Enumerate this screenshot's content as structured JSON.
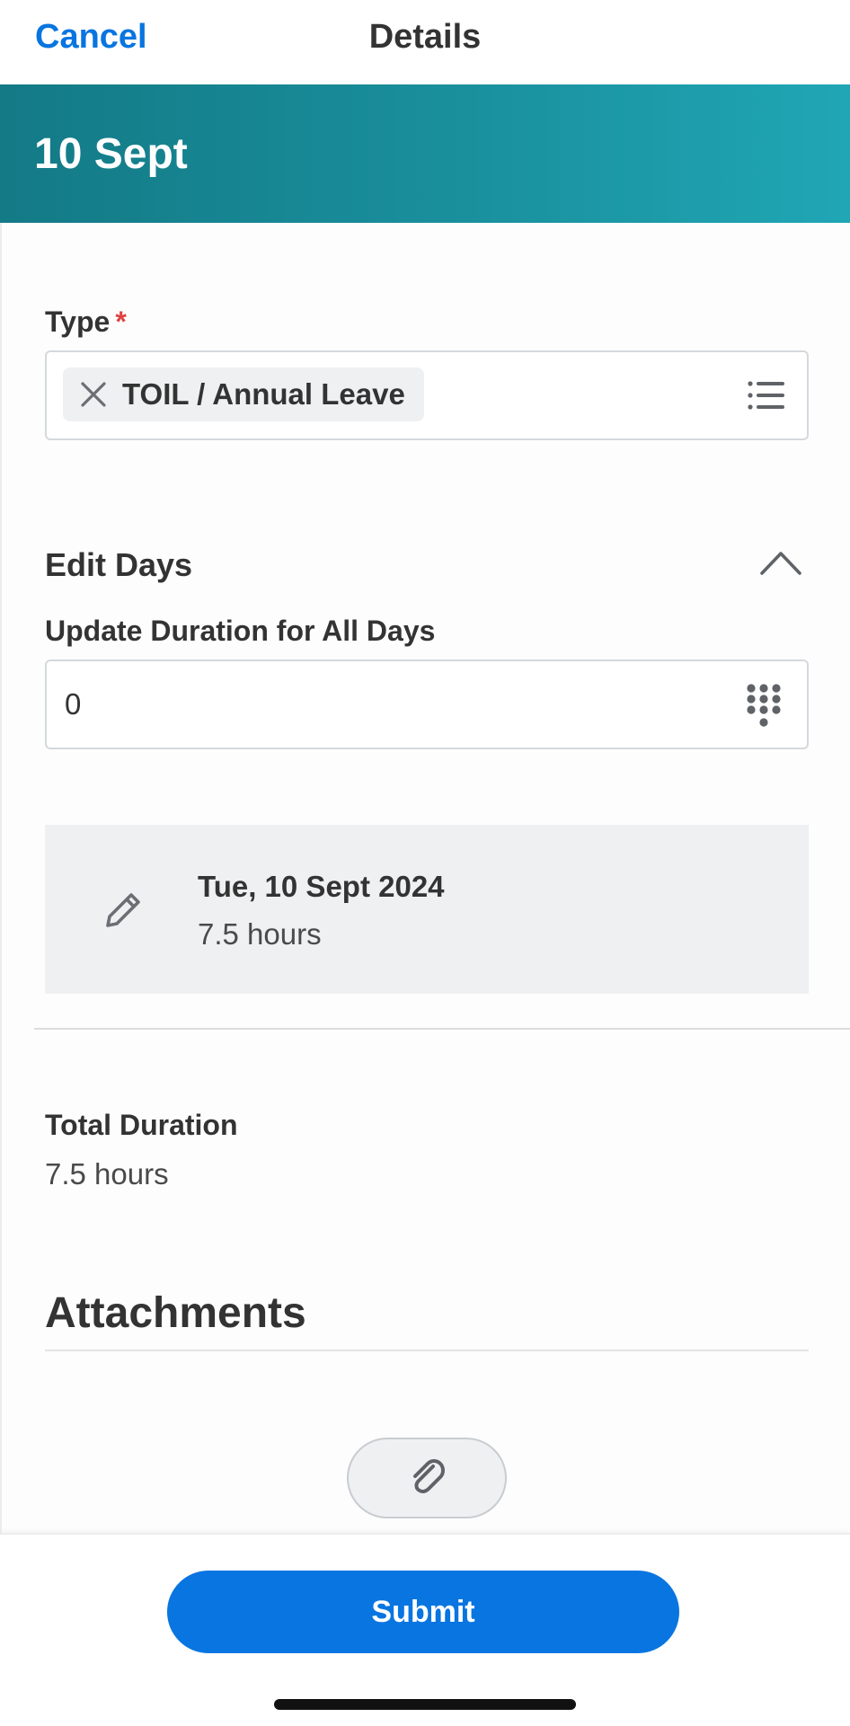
{
  "header": {
    "cancel_label": "Cancel",
    "title": "Details"
  },
  "banner": {
    "title": "10 Sept"
  },
  "type_field": {
    "label": "Type",
    "required_marker": "*",
    "selected_value": "TOIL / Annual Leave",
    "remove_icon": "close-icon",
    "picker_icon": "list-icon"
  },
  "edit_days": {
    "title": "Edit Days",
    "toggle_icon": "chevron-up-icon",
    "update_label": "Update Duration for All Days",
    "duration_value": "0",
    "keypad_icon": "keypad-icon",
    "days": [
      {
        "date": "Tue, 10 Sept 2024",
        "hours": "7.5 hours",
        "edit_icon": "pencil-icon"
      }
    ]
  },
  "total": {
    "label": "Total Duration",
    "value": "7.5 hours"
  },
  "attachments": {
    "title": "Attachments",
    "add_icon": "paperclip-icon"
  },
  "footer": {
    "submit_label": "Submit"
  },
  "colors": {
    "accent": "#0875e1",
    "banner_start": "#137a86",
    "banner_end": "#20a6b5",
    "required": "#de4242"
  }
}
